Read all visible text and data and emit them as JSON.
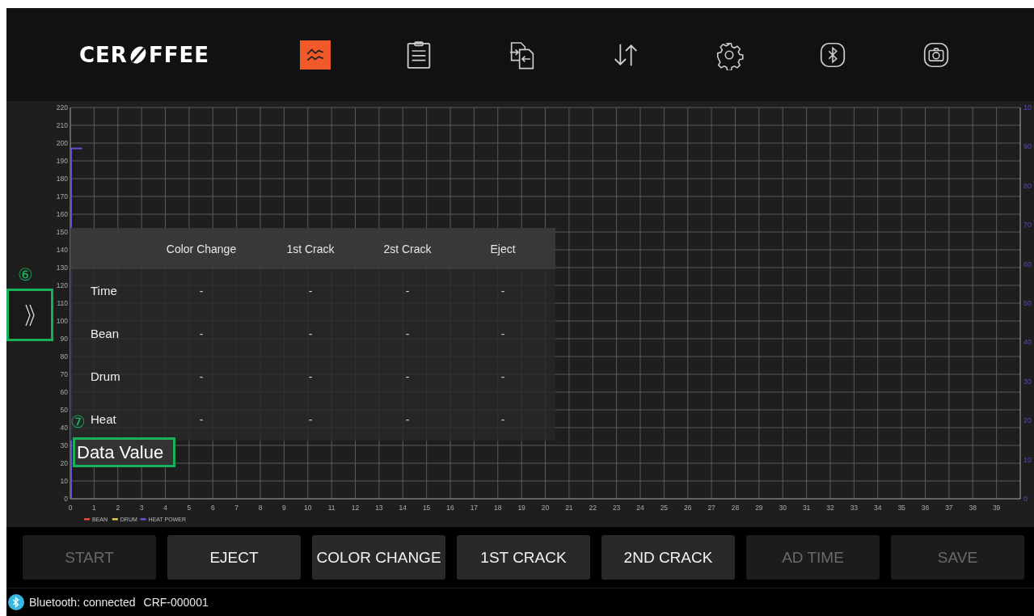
{
  "header": {
    "logo": {
      "left": "CER",
      "right": "FFEE"
    },
    "nav": [
      {
        "kind": "chart",
        "selected": true
      },
      {
        "kind": "clipboard",
        "selected": false
      },
      {
        "kind": "transfer",
        "selected": false
      },
      {
        "kind": "sort",
        "selected": false
      },
      {
        "kind": "settings",
        "selected": false
      },
      {
        "kind": "bluetooth",
        "selected": false
      },
      {
        "kind": "camera",
        "selected": false
      }
    ]
  },
  "chart": {
    "chart_data": {
      "type": "line",
      "grid": true,
      "xlim": [
        0,
        40
      ],
      "ylim": [
        0,
        220
      ],
      "xticks": [
        0,
        1,
        2,
        3,
        4,
        5,
        6,
        7,
        8,
        9,
        10,
        11,
        12,
        13,
        14,
        15,
        16,
        17,
        18,
        19,
        20,
        21,
        22,
        23,
        24,
        25,
        26,
        27,
        28,
        29,
        30,
        31,
        32,
        33,
        34,
        35,
        36,
        37,
        38,
        39
      ],
      "yticks": [
        0,
        10,
        20,
        30,
        40,
        50,
        60,
        70,
        80,
        90,
        100,
        110,
        120,
        130,
        140,
        150,
        160,
        170,
        180,
        190,
        200,
        210,
        220
      ],
      "y2lim": [
        0,
        100
      ],
      "y2ticks": [
        0,
        10,
        20,
        30,
        40,
        50,
        60,
        70,
        80,
        90
      ],
      "x": [
        0,
        0.5
      ],
      "series": [
        {
          "name": "BEAN",
          "color": "#e0503a",
          "values": [
            null,
            null
          ]
        },
        {
          "name": "DRUM",
          "color": "#e8c840",
          "values": [
            null,
            null
          ]
        },
        {
          "name": "HEAT POWER",
          "color": "#6a4fd0",
          "values": [
            197,
            197
          ]
        }
      ]
    },
    "right_axis_top_label": "10",
    "table": {
      "columns": [
        "",
        "Color Change",
        "1st Crack",
        "2st Crack",
        "Eject"
      ],
      "rows": [
        [
          "Time",
          "-",
          "-",
          "-",
          "-"
        ],
        [
          "Bean",
          "-",
          "-",
          "-",
          "-"
        ],
        [
          "Drum",
          "-",
          "-",
          "-",
          "-"
        ],
        [
          "Heat",
          "-",
          "-",
          "-",
          "-"
        ]
      ]
    },
    "annotations": [
      {
        "number": "⑥"
      },
      {
        "number": "⑦",
        "label": "Data Value"
      }
    ]
  },
  "buttons": [
    {
      "label": "START",
      "disabled": true
    },
    {
      "label": "EJECT",
      "disabled": false
    },
    {
      "label": "COLOR CHANGE",
      "disabled": false
    },
    {
      "label": "1ST CRACK",
      "disabled": false
    },
    {
      "label": "2ND CRACK",
      "disabled": false
    },
    {
      "label": "AD TIME",
      "disabled": true
    },
    {
      "label": "SAVE",
      "disabled": true
    }
  ],
  "status_bar": {
    "state": "Bluetooth: connected",
    "device": "CRF-000001"
  }
}
